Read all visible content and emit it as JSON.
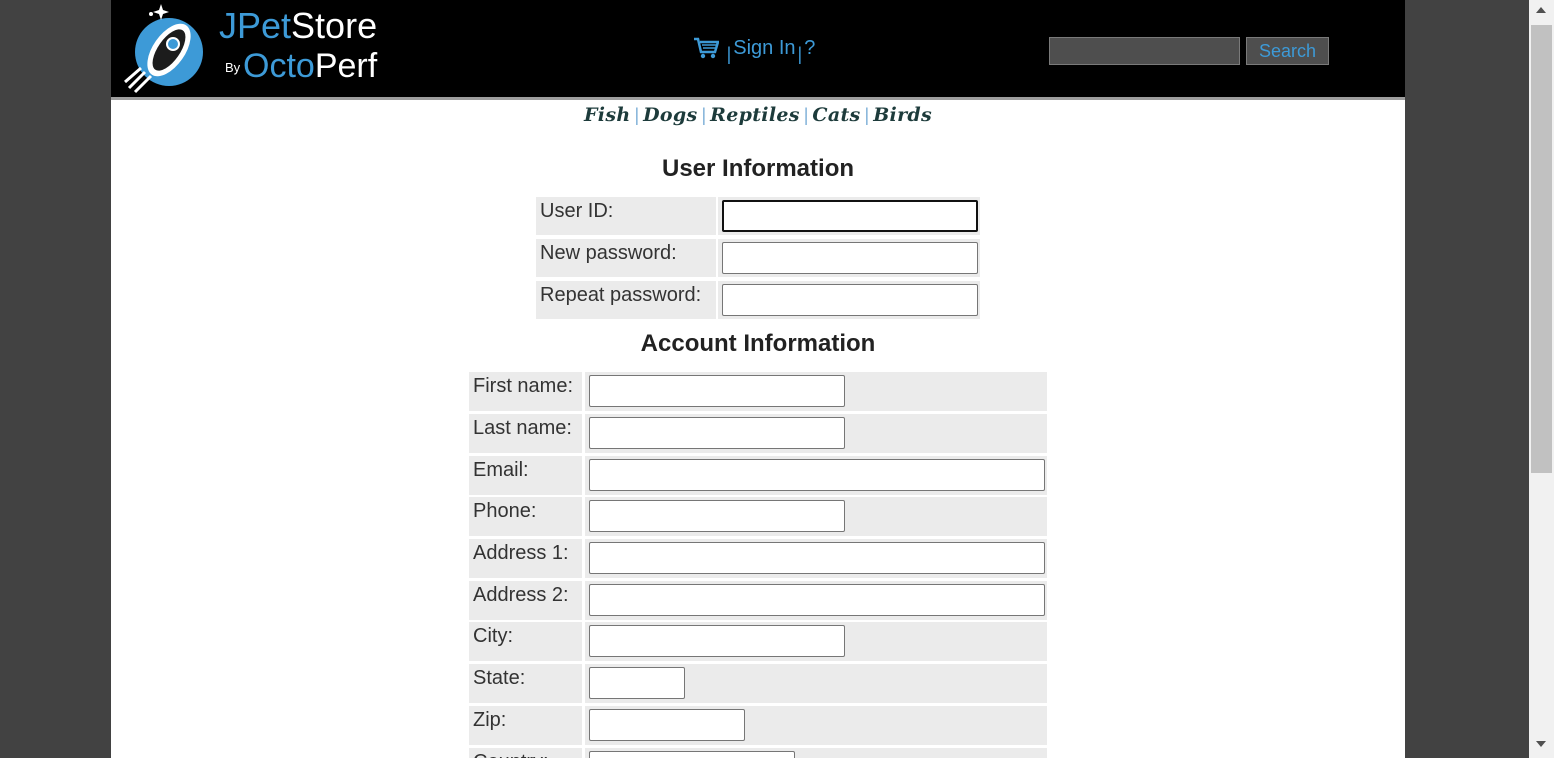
{
  "header": {
    "logo": {
      "brand_j": "J",
      "brand_pet": "Pet",
      "brand_store": "Store",
      "by": "By",
      "octo": "Octo",
      "perf": "Perf"
    },
    "menu": {
      "cart_icon": "cart-icon",
      "sign_in": "Sign In",
      "separator": "|",
      "help": "?"
    },
    "search": {
      "value": "",
      "button_label": "Search"
    }
  },
  "quicklinks": [
    "Fish",
    "Dogs",
    "Reptiles",
    "Cats",
    "Birds"
  ],
  "quicklinks_separator": "|",
  "user_info": {
    "title": "User Information",
    "fields": [
      {
        "label": "User ID:",
        "value": ""
      },
      {
        "label": "New password:",
        "value": ""
      },
      {
        "label": "Repeat password:",
        "value": ""
      }
    ]
  },
  "account_info": {
    "title": "Account Information",
    "fields": [
      {
        "label": "First name:",
        "value": ""
      },
      {
        "label": "Last name:",
        "value": ""
      },
      {
        "label": "Email:",
        "value": ""
      },
      {
        "label": "Phone:",
        "value": ""
      },
      {
        "label": "Address 1:",
        "value": ""
      },
      {
        "label": "Address 2:",
        "value": ""
      },
      {
        "label": "City:",
        "value": ""
      },
      {
        "label": "State:",
        "value": ""
      },
      {
        "label": "Zip:",
        "value": ""
      },
      {
        "label": "Country:",
        "value": ""
      }
    ]
  },
  "colors": {
    "accent": "#3d9ad7",
    "header_bg": "#000000",
    "cell_bg": "#ebebeb"
  }
}
